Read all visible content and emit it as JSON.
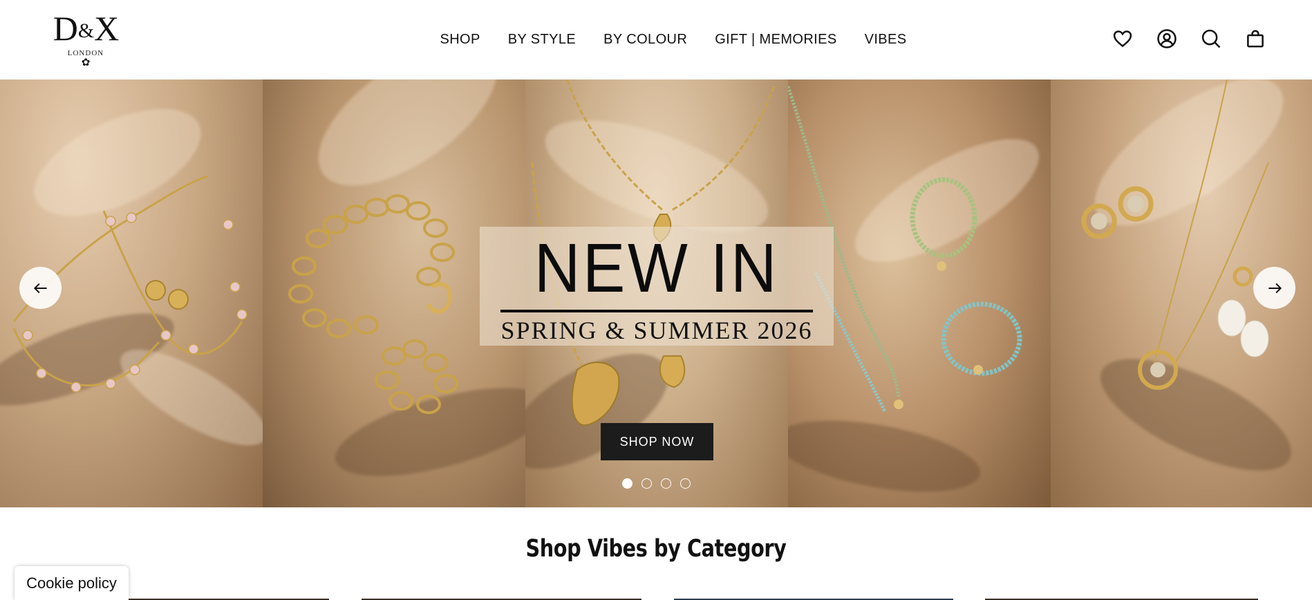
{
  "header": {
    "logo": {
      "mark_left": "D",
      "mark_amp": "&",
      "mark_right": "X",
      "sub": "LONDON",
      "flower": "✿"
    },
    "nav": [
      "SHOP",
      "BY STYLE",
      "BY COLOUR",
      "GIFT | MEMORIES",
      "VIBES"
    ],
    "icons": [
      "heart-icon",
      "account-icon",
      "search-icon",
      "bag-icon"
    ]
  },
  "hero": {
    "title": "NEW IN",
    "subtitle": "SPRING & SUMMER 2026",
    "cta": "SHOP NOW",
    "slides": 4,
    "active_slide": 1
  },
  "section": {
    "title": "Shop Vibes by Category"
  },
  "cookie": {
    "label": "Cookie policy"
  },
  "colors": {
    "button_bg": "#1c1c1c",
    "text": "#111111",
    "satin": "#c9a884"
  }
}
